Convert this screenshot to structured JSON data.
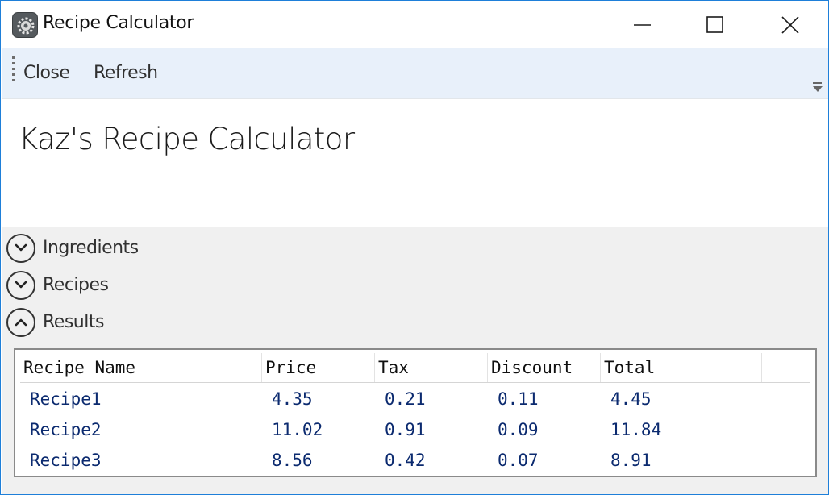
{
  "window": {
    "title": "Recipe Calculator",
    "accent": "#1e7fd9"
  },
  "toolbar": {
    "close_label": "Close",
    "refresh_label": "Refresh"
  },
  "page": {
    "heading": "Kaz's Recipe Calculator"
  },
  "expanders": [
    {
      "label": "Ingredients",
      "expanded": false
    },
    {
      "label": "Recipes",
      "expanded": false
    },
    {
      "label": "Results",
      "expanded": true
    }
  ],
  "results_grid": {
    "columns": [
      "Recipe Name",
      "Price",
      "Tax",
      "Discount",
      "Total"
    ],
    "rows": [
      [
        "Recipe1",
        "4.35",
        "0.21",
        "0.11",
        "4.45"
      ],
      [
        "Recipe2",
        "11.02",
        "0.91",
        "0.09",
        "11.84"
      ],
      [
        "Recipe3",
        "8.56",
        "0.42",
        "0.07",
        "8.91"
      ]
    ],
    "text_color": "#0b2a6f"
  }
}
